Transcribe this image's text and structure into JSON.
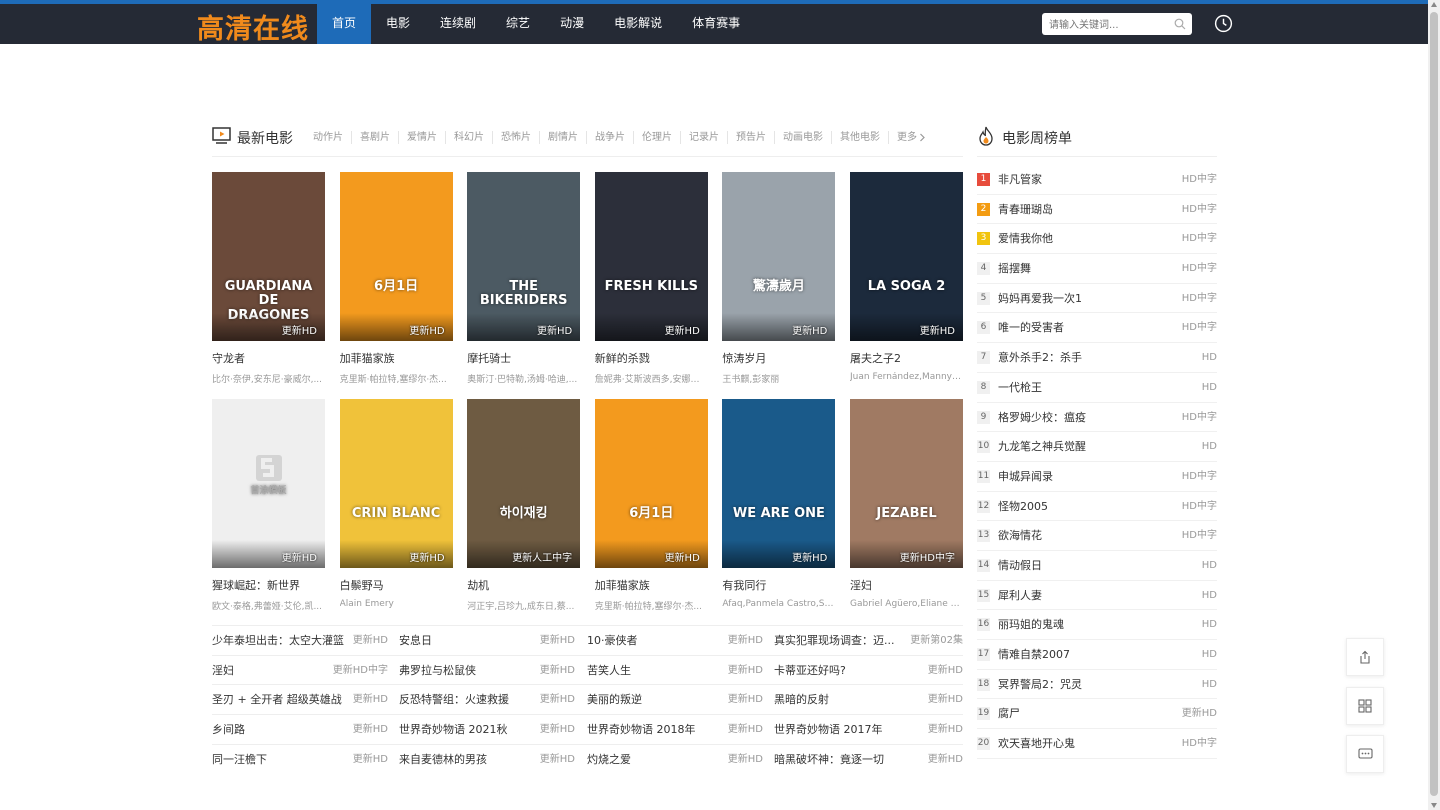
{
  "site": {
    "logo": "高清在线"
  },
  "nav": [
    "首页",
    "电影",
    "连续剧",
    "综艺",
    "动漫",
    "电影解说",
    "体育赛事"
  ],
  "search": {
    "placeholder": "请输入关键词..."
  },
  "section": {
    "title": "最新电影",
    "categories": [
      "动作片",
      "喜剧片",
      "爱情片",
      "科幻片",
      "恐怖片",
      "剧情片",
      "战争片",
      "伦理片",
      "记录片",
      "预告片",
      "动画电影",
      "其他电影"
    ],
    "more": "更多"
  },
  "movies": [
    {
      "title": "守龙者",
      "actors": "比尔·奈伊,安东尼·豪威尔,...",
      "tag": "更新HD",
      "bg": "#6b4a3a"
    },
    {
      "title": "加菲猫家族",
      "actors": "克里斯·帕拉特,塞缪尔·杰...",
      "tag": "更新HD",
      "bg": "#f39a1e"
    },
    {
      "title": "摩托骑士",
      "actors": "奥斯汀·巴特勒,汤姆·哈迪,...",
      "tag": "更新HD",
      "bg": "#4c5a63"
    },
    {
      "title": "新鲜的杀戮",
      "actors": "詹妮弗·艾斯波西多,安娜贝...",
      "tag": "更新HD",
      "bg": "#2c2f3a"
    },
    {
      "title": "惊涛岁月",
      "actors": "王书麒,彭家丽",
      "tag": "更新HD",
      "bg": "#9aa3ab"
    },
    {
      "title": "屠夫之子2",
      "actors": "Juan Fernández,Manny ...",
      "tag": "更新HD",
      "bg": "#1c2a3c"
    },
    {
      "title": "猩球崛起：新世界",
      "actors": "欧文·泰格,弗蕾娅·艾伦,凯...",
      "tag": "更新HD",
      "bg": "#efefef"
    },
    {
      "title": "白鬃野马",
      "actors": "Alain Emery",
      "tag": "更新HD",
      "bg": "#f0c23a"
    },
    {
      "title": "劫机",
      "actors": "河正宇,吕珍九,成东日,蔡...",
      "tag": "更新人工中字",
      "bg": "#6e5b42"
    },
    {
      "title": "加菲猫家族",
      "actors": "克里斯·帕拉特,塞缪尔·杰...",
      "tag": "更新HD",
      "bg": "#f39a1e"
    },
    {
      "title": "有我同行",
      "actors": "Afaq,Panmela Castro,Sté...",
      "tag": "更新HD",
      "bg": "#1a5a8a"
    },
    {
      "title": "淫妇",
      "actors": "Gabriel Agüero,Eliane C...",
      "tag": "更新HD中字",
      "bg": "#a07a63"
    }
  ],
  "poster_text": [
    "GUARDIANA DE DRAGONES",
    "6月1日",
    "THE BIKERIDERS",
    "FRESH KILLS",
    "驚濤歲月",
    "LA SOGA 2",
    "首涂模板",
    "CRIN BLANC",
    "하이재킹",
    "6月1日",
    "WE ARE ONE",
    "JEZABEL"
  ],
  "list": [
    [
      {
        "name": "少年泰坦出击：太空大灌篮",
        "status": "更新HD"
      },
      {
        "name": "安息日",
        "status": "更新HD"
      },
      {
        "name": "10·豪侠者",
        "status": "更新HD"
      },
      {
        "name": "真实犯罪现场调查：迈...",
        "status": "更新第02集"
      }
    ],
    [
      {
        "name": "淫妇",
        "status": "更新HD中字"
      },
      {
        "name": "弗罗拉与松鼠侠",
        "status": "更新HD"
      },
      {
        "name": "苦笑人生",
        "status": "更新HD"
      },
      {
        "name": "卡蒂亚还好吗?",
        "status": "更新HD"
      }
    ],
    [
      {
        "name": "圣刃 + 全开者 超级英雄战",
        "status": "更新HD"
      },
      {
        "name": "反恐特警组：火速救援",
        "status": "更新HD"
      },
      {
        "name": "美丽的叛逆",
        "status": "更新HD"
      },
      {
        "name": "黑暗的反射",
        "status": "更新HD"
      }
    ],
    [
      {
        "name": "乡间路",
        "status": "更新HD"
      },
      {
        "name": "世界奇妙物语 2021秋",
        "status": "更新HD"
      },
      {
        "name": "世界奇妙物语 2018年",
        "status": "更新HD"
      },
      {
        "name": "世界奇妙物语 2017年",
        "status": "更新HD"
      }
    ],
    [
      {
        "name": "同一汪檐下",
        "status": "更新HD"
      },
      {
        "name": "来自麦德林的男孩",
        "status": "更新HD"
      },
      {
        "name": "灼烧之爱",
        "status": "更新HD"
      },
      {
        "name": "暗黑破坏神：竟逐一切",
        "status": "更新HD"
      }
    ]
  ],
  "rank": {
    "title": "电影周榜单",
    "items": [
      {
        "num": "1",
        "name": "非凡管家",
        "status": "HD中字"
      },
      {
        "num": "2",
        "name": "青春珊瑚岛",
        "status": "HD中字"
      },
      {
        "num": "3",
        "name": "爱情我你他",
        "status": "HD中字"
      },
      {
        "num": "4",
        "name": "摇摆舞",
        "status": "HD中字"
      },
      {
        "num": "5",
        "name": "妈妈再爱我一次1",
        "status": "HD中字"
      },
      {
        "num": "6",
        "name": "唯一的受害者",
        "status": "HD中字"
      },
      {
        "num": "7",
        "name": "意外杀手2：杀手",
        "status": "HD"
      },
      {
        "num": "8",
        "name": "一代枪王",
        "status": "HD"
      },
      {
        "num": "9",
        "name": "格罗姆少校：瘟疫",
        "status": "HD中字"
      },
      {
        "num": "10",
        "name": "九龙笔之神兵觉醒",
        "status": "HD"
      },
      {
        "num": "11",
        "name": "申城异闻录",
        "status": "HD中字"
      },
      {
        "num": "12",
        "name": "怪物2005",
        "status": "HD中字"
      },
      {
        "num": "13",
        "name": "欲海情花",
        "status": "HD中字"
      },
      {
        "num": "14",
        "name": "情动假日",
        "status": "HD"
      },
      {
        "num": "15",
        "name": "犀利人妻",
        "status": "HD"
      },
      {
        "num": "16",
        "name": "丽玛姐的鬼魂",
        "status": "HD"
      },
      {
        "num": "17",
        "name": "情难自禁2007",
        "status": "HD"
      },
      {
        "num": "18",
        "name": "冥界警局2：咒灵",
        "status": "HD"
      },
      {
        "num": "19",
        "name": "腐尸",
        "status": "更新HD"
      },
      {
        "num": "20",
        "name": "欢天喜地开心鬼",
        "status": "HD中字"
      }
    ]
  }
}
